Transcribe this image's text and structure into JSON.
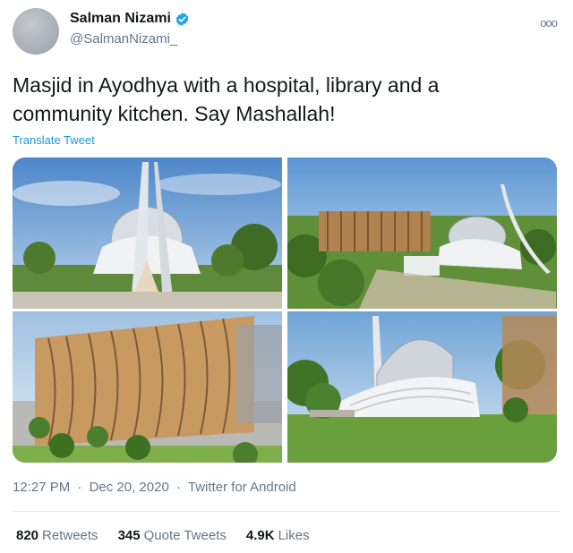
{
  "author": {
    "display_name": "Salman Nizami",
    "handle": "@SalmanNizami_",
    "verified": true
  },
  "more_icon": "ooo",
  "tweet": {
    "text_line1": "Masjid in Ayodhya with a hospital, library and a",
    "text_line2": "community kitchen. Say Mashallah!",
    "translate_label": "Translate Tweet"
  },
  "media": [
    {
      "icon": "mosque-front-render"
    },
    {
      "icon": "complex-aerial-render"
    },
    {
      "icon": "hospital-building-render"
    },
    {
      "icon": "dome-side-render"
    }
  ],
  "meta": {
    "time": "12:27 PM",
    "separator": "·",
    "date": "Dec 20, 2020",
    "source": "Twitter for Android"
  },
  "stats": {
    "retweets_count": "820",
    "retweets_label": "Retweets",
    "quotes_count": "345",
    "quotes_label": "Quote Tweets",
    "likes_count": "4.9K",
    "likes_label": "Likes"
  },
  "colors": {
    "link": "#1b95e0",
    "secondary_text": "#657786",
    "verified": "#1da1f2"
  }
}
